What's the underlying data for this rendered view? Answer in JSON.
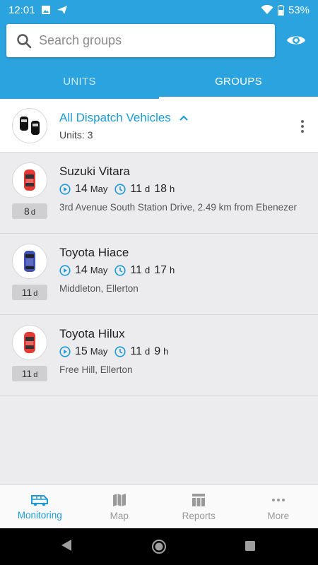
{
  "status_bar": {
    "time": "12:01",
    "battery": "53%"
  },
  "search": {
    "placeholder": "Search groups"
  },
  "tabs": [
    {
      "label": "UNITS",
      "active": false
    },
    {
      "label": "GROUPS",
      "active": true
    }
  ],
  "group": {
    "name": "All Dispatch Vehicles",
    "units_label": "Units: 3"
  },
  "units": [
    {
      "name": "Suzuki Vitara",
      "car_color": "#e53935",
      "badge_num": "8",
      "badge_unit": "d",
      "date_day": "14",
      "date_month": "May",
      "dur_days": "11",
      "dur_d": "d",
      "dur_hours": "18",
      "dur_h": "h",
      "address": "3rd Avenue South Station Drive, 2.49 km from Ebenezer"
    },
    {
      "name": "Toyota Hiace",
      "car_color": "#3f51b5",
      "badge_num": "11",
      "badge_unit": "d",
      "date_day": "14",
      "date_month": "May",
      "dur_days": "11",
      "dur_d": "d",
      "dur_hours": "17",
      "dur_h": "h",
      "address": "Middleton, Ellerton"
    },
    {
      "name": "Toyota Hilux",
      "car_color": "#e53935",
      "badge_num": "11",
      "badge_unit": "d",
      "date_day": "15",
      "date_month": "May",
      "dur_days": "11",
      "dur_d": "d",
      "dur_hours": "9",
      "dur_h": "h",
      "address": "Free Hill, Ellerton"
    }
  ],
  "bottom_nav": [
    {
      "label": "Monitoring",
      "icon": "van-icon",
      "active": true
    },
    {
      "label": "Map",
      "icon": "map-icon",
      "active": false
    },
    {
      "label": "Reports",
      "icon": "table-icon",
      "active": false
    },
    {
      "label": "More",
      "icon": "more-dots-icon",
      "active": false
    }
  ],
  "colors": {
    "primary": "#2ba3df",
    "accent": "#1c9bd7",
    "inactive": "#9a9a9a"
  }
}
